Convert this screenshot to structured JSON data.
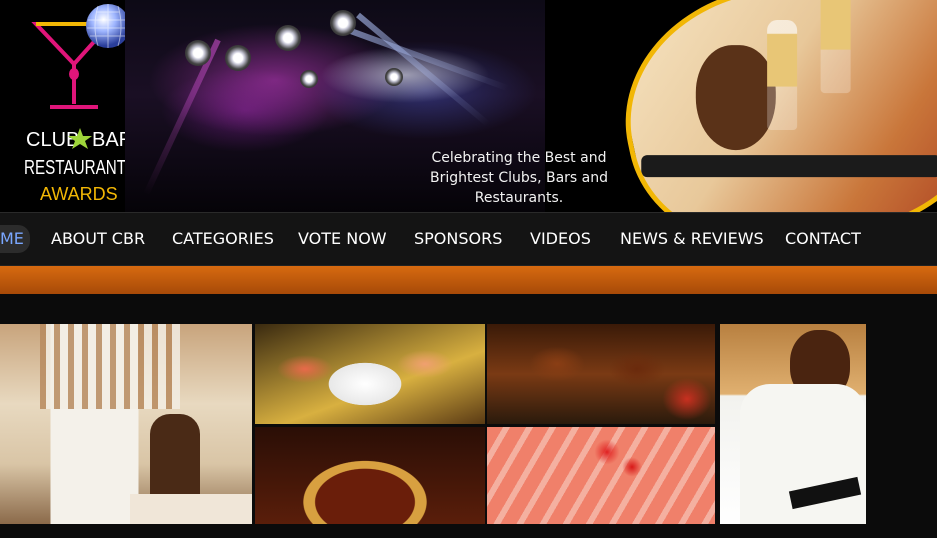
{
  "logo": {
    "line1_left": "CLUB",
    "line1_right": "BAR",
    "line2": "RESTAURANT",
    "line3": "AWARDS"
  },
  "tagline": "Celebrating the Best and Brightest Clubs, Bars and Restaurants.",
  "nav": {
    "items": [
      {
        "label": "ME"
      },
      {
        "label": "ABOUT CBR"
      },
      {
        "label": "CATEGORIES"
      },
      {
        "label": "VOTE NOW"
      },
      {
        "label": "SPONSORS"
      },
      {
        "label": "VIDEOS"
      },
      {
        "label": "NEWS & REVIEWS"
      },
      {
        "label": "CONTACT"
      }
    ]
  },
  "colors": {
    "accent_orange": "#d76a10",
    "frame_gold": "#f2b705",
    "logo_magenta": "#e0157a",
    "logo_gold": "#f2b705"
  }
}
